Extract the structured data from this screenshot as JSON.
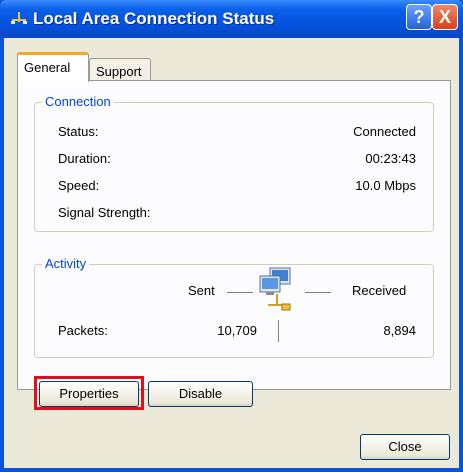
{
  "window": {
    "title": "Local Area Connection Status",
    "help_glyph": "?",
    "close_glyph": "X"
  },
  "tabs": [
    {
      "label": "General",
      "selected": true
    },
    {
      "label": "Support",
      "selected": false
    }
  ],
  "connection": {
    "legend": "Connection",
    "rows": [
      {
        "label": "Status:",
        "value": "Connected"
      },
      {
        "label": "Duration:",
        "value": "00:23:43"
      },
      {
        "label": "Speed:",
        "value": "10.0 Mbps"
      },
      {
        "label": "Signal Strength:",
        "value": ""
      }
    ]
  },
  "activity": {
    "legend": "Activity",
    "sent_label": "Sent",
    "received_label": "Received",
    "packets_label": "Packets:",
    "packets_sent": "10,709",
    "packets_received": "8,894"
  },
  "buttons": {
    "properties": "Properties",
    "disable": "Disable",
    "close": "Close"
  },
  "colors": {
    "titlebar": "#0a5fe8",
    "group_legend": "#0046d5",
    "highlight": "#e0101a"
  }
}
